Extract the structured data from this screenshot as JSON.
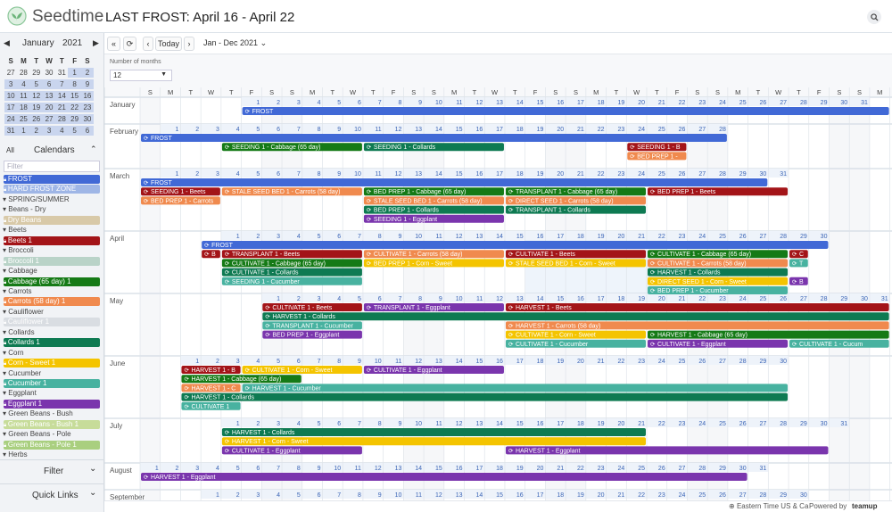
{
  "app": {
    "brand": "Seedtime",
    "title": "LAST FROST: April 16 - April 22"
  },
  "minical": {
    "month": "January",
    "year": "2021",
    "dow": [
      "S",
      "M",
      "T",
      "W",
      "T",
      "F",
      "S"
    ],
    "weeks": [
      [
        "27",
        "28",
        "29",
        "30",
        "31",
        "1",
        "2"
      ],
      [
        "3",
        "4",
        "5",
        "6",
        "7",
        "8",
        "9"
      ],
      [
        "10",
        "11",
        "12",
        "13",
        "14",
        "15",
        "16"
      ],
      [
        "17",
        "18",
        "19",
        "20",
        "21",
        "22",
        "23"
      ],
      [
        "24",
        "25",
        "26",
        "27",
        "28",
        "29",
        "30"
      ],
      [
        "31",
        "1",
        "2",
        "3",
        "4",
        "5",
        "6"
      ]
    ]
  },
  "sidebar": {
    "all_label": "All",
    "calendars_label": "Calendars",
    "filter_placeholder": "Filter",
    "filter_label": "Filter",
    "quicklinks_label": "Quick Links",
    "items": [
      {
        "label": "FROST",
        "kind": "cal",
        "color": "#4169d6",
        "text": "#fff",
        "icon": "lock"
      },
      {
        "label": "HARD FROST ZONE",
        "kind": "cal",
        "color": "#9fb6e6",
        "text": "#fff",
        "icon": "lock"
      },
      {
        "label": "SPRING/SUMMER",
        "kind": "group",
        "icon": "triangle"
      },
      {
        "label": "Beans - Dry",
        "kind": "group",
        "icon": "triangle"
      },
      {
        "label": "Dry Beans",
        "kind": "cal",
        "color": "#d8c9a8",
        "text": "#fff",
        "icon": "lock"
      },
      {
        "label": "Beets",
        "kind": "group",
        "icon": "triangle"
      },
      {
        "label": "Beets 1",
        "kind": "cal",
        "color": "#a31418",
        "text": "#fff",
        "icon": "lock"
      },
      {
        "label": "Broccoli",
        "kind": "group",
        "icon": "triangle"
      },
      {
        "label": "Broccoli 1",
        "kind": "cal",
        "color": "#b9d3c8",
        "text": "#fff",
        "icon": "lock"
      },
      {
        "label": "Cabbage",
        "kind": "group",
        "icon": "triangle"
      },
      {
        "label": "Cabbage (65 day) 1",
        "kind": "cal",
        "color": "#157a16",
        "text": "#fff",
        "icon": "lock"
      },
      {
        "label": "Carrots",
        "kind": "group",
        "icon": "triangle"
      },
      {
        "label": "Carrots (58 day) 1",
        "kind": "cal",
        "color": "#f08a4e",
        "text": "#fff",
        "icon": "lock"
      },
      {
        "label": "Cauliflower",
        "kind": "group",
        "icon": "triangle"
      },
      {
        "label": "Cauliflower 1",
        "kind": "cal",
        "color": "#d9dde2",
        "text": "#fff",
        "icon": "lock"
      },
      {
        "label": "Collards",
        "kind": "group",
        "icon": "triangle"
      },
      {
        "label": "Collards 1",
        "kind": "cal",
        "color": "#0e7a52",
        "text": "#fff",
        "icon": "lock"
      },
      {
        "label": "Corn",
        "kind": "group",
        "icon": "triangle"
      },
      {
        "label": "Corn - Sweet 1",
        "kind": "cal",
        "color": "#f4c400",
        "text": "#fff",
        "icon": "lock"
      },
      {
        "label": "Cucumber",
        "kind": "group",
        "icon": "triangle"
      },
      {
        "label": "Cucumber 1",
        "kind": "cal",
        "color": "#48b2a0",
        "text": "#fff",
        "icon": "lock"
      },
      {
        "label": "Eggplant",
        "kind": "group",
        "icon": "triangle"
      },
      {
        "label": "Eggplant 1",
        "kind": "cal",
        "color": "#7a35ad",
        "text": "#fff",
        "icon": "lock"
      },
      {
        "label": "Green Beans - Bush",
        "kind": "group",
        "icon": "triangle"
      },
      {
        "label": "Green Beans - Bush 1",
        "kind": "cal",
        "color": "#c7dc9a",
        "text": "#fff",
        "icon": "lock"
      },
      {
        "label": "Green Beans - Pole",
        "kind": "group",
        "icon": "triangle"
      },
      {
        "label": "Green Beans - Pole 1",
        "kind": "cal",
        "color": "#a9cf7f",
        "text": "#fff",
        "icon": "lock"
      },
      {
        "label": "Herbs",
        "kind": "group",
        "icon": "triangle"
      }
    ]
  },
  "toolbar": {
    "today": "Today",
    "range": "Jan - Dec 2021",
    "months_label": "Number of months",
    "months_value": "12"
  },
  "dow_header": [
    "S",
    "M",
    "T",
    "W",
    "T",
    "F",
    "S",
    "S",
    "M",
    "T",
    "W",
    "T",
    "F",
    "S",
    "S",
    "M",
    "T",
    "W",
    "T",
    "F",
    "S",
    "S",
    "M",
    "T",
    "W",
    "T",
    "F",
    "S",
    "S",
    "M",
    "T",
    "W",
    "T",
    "F",
    "S",
    "S",
    "M"
  ],
  "months": [
    {
      "name": "January",
      "start": 5,
      "days": 31
    },
    {
      "name": "February",
      "start": 1,
      "days": 28
    },
    {
      "name": "March",
      "start": 1,
      "days": 31
    },
    {
      "name": "April",
      "start": 4,
      "days": 30
    },
    {
      "name": "May",
      "start": 6,
      "days": 31
    },
    {
      "name": "June",
      "start": 2,
      "days": 30
    },
    {
      "name": "July",
      "start": 4,
      "days": 31
    },
    {
      "name": "August",
      "start": 0,
      "days": 31
    },
    {
      "name": "September",
      "start": 3,
      "days": 30
    }
  ],
  "colors": {
    "frost": "#4169d6",
    "beets": "#a31418",
    "cabbage": "#157a16",
    "carrots": "#f08a4e",
    "collards": "#0e7a52",
    "corn": "#f4c400",
    "cucumber": "#48b2a0",
    "eggplant": "#7a35ad",
    "frostzone": "#eef4fb"
  },
  "events": [
    {
      "m": 0,
      "lane": 0,
      "s": 5,
      "e": 36,
      "label": "FROST",
      "c": "frost"
    },
    {
      "m": 1,
      "lane": 0,
      "s": 0,
      "e": 28,
      "label": "FROST",
      "c": "frost"
    },
    {
      "m": 1,
      "lane": 1,
      "s": 4,
      "e": 10,
      "label": "SEEDING 1 - Cabbage (65 day)",
      "c": "cabbage"
    },
    {
      "m": 1,
      "lane": 1,
      "s": 11,
      "e": 17,
      "label": "SEEDING 1 - Collards",
      "c": "collards"
    },
    {
      "m": 1,
      "lane": 1,
      "s": 24,
      "e": 26,
      "label": "SEEDING 1 - B",
      "c": "beets"
    },
    {
      "m": 1,
      "lane": 2,
      "s": 24,
      "e": 26,
      "label": "BED PREP 1 -",
      "c": "carrots"
    },
    {
      "m": 2,
      "lane": 0,
      "s": 0,
      "e": 30,
      "label": "FROST",
      "c": "frost"
    },
    {
      "m": 2,
      "lane": 1,
      "s": 0,
      "e": 3,
      "label": "SEEDING 1 - Beets",
      "c": "beets"
    },
    {
      "m": 2,
      "lane": 1,
      "s": 4,
      "e": 10,
      "label": "STALE SEED BED 1 - Carrots (58 day)",
      "c": "carrots"
    },
    {
      "m": 2,
      "lane": 1,
      "s": 11,
      "e": 17,
      "label": "BED PREP 1 - Cabbage (65 day)",
      "c": "cabbage"
    },
    {
      "m": 2,
      "lane": 1,
      "s": 18,
      "e": 24,
      "label": "TRANSPLANT 1 - Cabbage (65 day)",
      "c": "cabbage"
    },
    {
      "m": 2,
      "lane": 1,
      "s": 25,
      "e": 31,
      "label": "BED PREP 1 - Beets",
      "c": "beets"
    },
    {
      "m": 2,
      "lane": 2,
      "s": 0,
      "e": 3,
      "label": "BED PREP 1 - Carrots",
      "c": "carrots"
    },
    {
      "m": 2,
      "lane": 2,
      "s": 11,
      "e": 17,
      "label": "STALE SEED BED 1 - Carrots (58 day)",
      "c": "carrots"
    },
    {
      "m": 2,
      "lane": 2,
      "s": 18,
      "e": 24,
      "label": "DIRECT SEED 1 - Carrots (58 day)",
      "c": "carrots"
    },
    {
      "m": 2,
      "lane": 3,
      "s": 11,
      "e": 17,
      "label": "BED PREP 1 - Collards",
      "c": "collards"
    },
    {
      "m": 2,
      "lane": 3,
      "s": 18,
      "e": 24,
      "label": "TRANSPLANT 1 - Collards",
      "c": "collards"
    },
    {
      "m": 2,
      "lane": 4,
      "s": 11,
      "e": 17,
      "label": "SEEDING 1 - Eggplant",
      "c": "eggplant"
    },
    {
      "m": 3,
      "lane": 0,
      "s": 3,
      "e": 33,
      "label": "FROST",
      "c": "frost"
    },
    {
      "m": 3,
      "lane": 1,
      "s": 3,
      "e": 3,
      "label": "B",
      "c": "beets"
    },
    {
      "m": 3,
      "lane": 1,
      "s": 4,
      "e": 10,
      "label": "TRANSPLANT 1 - Beets",
      "c": "beets"
    },
    {
      "m": 3,
      "lane": 1,
      "s": 11,
      "e": 17,
      "label": "CULTIVATE 1 - Carrots (58 day)",
      "c": "carrots"
    },
    {
      "m": 3,
      "lane": 1,
      "s": 18,
      "e": 24,
      "label": "CULTIVATE 1 - Beets",
      "c": "beets"
    },
    {
      "m": 3,
      "lane": 1,
      "s": 25,
      "e": 31,
      "label": "CULTIVATE 1 - Cabbage (65 day)",
      "c": "cabbage"
    },
    {
      "m": 3,
      "lane": 1,
      "s": 32,
      "e": 32,
      "label": "C",
      "c": "beets"
    },
    {
      "m": 3,
      "lane": 2,
      "s": 4,
      "e": 10,
      "label": "CULTIVATE 1 - Cabbage (65 day)",
      "c": "cabbage"
    },
    {
      "m": 3,
      "lane": 2,
      "s": 11,
      "e": 17,
      "label": "BED PREP 1 - Corn - Sweet",
      "c": "corn"
    },
    {
      "m": 3,
      "lane": 2,
      "s": 18,
      "e": 24,
      "label": "STALE SEED BED 1 - Corn - Sweet",
      "c": "corn"
    },
    {
      "m": 3,
      "lane": 2,
      "s": 25,
      "e": 31,
      "label": "CULTIVATE 1 - Carrots (58 day)",
      "c": "carrots"
    },
    {
      "m": 3,
      "lane": 2,
      "s": 32,
      "e": 32,
      "label": "T",
      "c": "cucumber"
    },
    {
      "m": 3,
      "lane": 3,
      "s": 4,
      "e": 10,
      "label": "CULTIVATE 1 - Collards",
      "c": "collards"
    },
    {
      "m": 3,
      "lane": 3,
      "s": 25,
      "e": 31,
      "label": "HARVEST 1 - Collards",
      "c": "collards"
    },
    {
      "m": 3,
      "lane": 4,
      "s": 4,
      "e": 10,
      "label": "SEEDING 1 - Cucumber",
      "c": "cucumber"
    },
    {
      "m": 3,
      "lane": 4,
      "s": 25,
      "e": 31,
      "label": "DIRECT SEED 1 - Corn - Sweet",
      "c": "corn"
    },
    {
      "m": 3,
      "lane": 4,
      "s": 32,
      "e": 32,
      "label": "B",
      "c": "eggplant"
    },
    {
      "m": 3,
      "lane": 5,
      "s": 25,
      "e": 31,
      "label": "BED PREP 1 - Cucumber",
      "c": "cucumber"
    },
    {
      "m": 4,
      "lane": 0,
      "s": 6,
      "e": 10,
      "label": "CULTIVATE 1 - Beets",
      "c": "beets"
    },
    {
      "m": 4,
      "lane": 0,
      "s": 11,
      "e": 17,
      "label": "TRANSPLANT 1 - Eggplant",
      "c": "eggplant"
    },
    {
      "m": 4,
      "lane": 0,
      "s": 18,
      "e": 36,
      "label": "HARVEST 1 - Beets",
      "c": "beets"
    },
    {
      "m": 4,
      "lane": 1,
      "s": 6,
      "e": 36,
      "label": "HARVEST 1 - Collards",
      "c": "collards"
    },
    {
      "m": 4,
      "lane": 2,
      "s": 6,
      "e": 10,
      "label": "TRANSPLANT 1 - Cucumber",
      "c": "cucumber"
    },
    {
      "m": 4,
      "lane": 2,
      "s": 18,
      "e": 36,
      "label": "HARVEST 1 - Carrots (58 day)",
      "c": "carrots"
    },
    {
      "m": 4,
      "lane": 3,
      "s": 6,
      "e": 10,
      "label": "BED PREP 1 - Eggplant",
      "c": "eggplant"
    },
    {
      "m": 4,
      "lane": 3,
      "s": 18,
      "e": 24,
      "label": "CULTIVATE 1 - Corn - Sweet",
      "c": "corn"
    },
    {
      "m": 4,
      "lane": 3,
      "s": 25,
      "e": 36,
      "label": "HARVEST 1 - Cabbage (65 day)",
      "c": "cabbage"
    },
    {
      "m": 4,
      "lane": 4,
      "s": 18,
      "e": 24,
      "label": "CULTIVATE 1 - Cucumber",
      "c": "cucumber"
    },
    {
      "m": 4,
      "lane": 4,
      "s": 25,
      "e": 31,
      "label": "CULTIVATE 1 - Eggplant",
      "c": "eggplant"
    },
    {
      "m": 4,
      "lane": 4,
      "s": 32,
      "e": 36,
      "label": "CULTIVATE 1 - Cucum",
      "c": "cucumber"
    },
    {
      "m": 5,
      "lane": 0,
      "s": 2,
      "e": 4,
      "label": "HARVEST 1 - B",
      "c": "beets"
    },
    {
      "m": 5,
      "lane": 0,
      "s": 5,
      "e": 10,
      "label": "CULTIVATE 1 - Corn - Sweet",
      "c": "corn"
    },
    {
      "m": 5,
      "lane": 0,
      "s": 11,
      "e": 17,
      "label": "CULTIVATE 1 - Eggplant",
      "c": "eggplant"
    },
    {
      "m": 5,
      "lane": 1,
      "s": 2,
      "e": 7,
      "label": "HARVEST 1 - Cabbage (65 day)",
      "c": "cabbage"
    },
    {
      "m": 5,
      "lane": 2,
      "s": 2,
      "e": 4,
      "label": "HARVEST 1 - C",
      "c": "carrots"
    },
    {
      "m": 5,
      "lane": 2,
      "s": 5,
      "e": 31,
      "label": "HARVEST 1 - Cucumber",
      "c": "cucumber"
    },
    {
      "m": 5,
      "lane": 3,
      "s": 2,
      "e": 31,
      "label": "HARVEST 1 - Collards",
      "c": "collards"
    },
    {
      "m": 5,
      "lane": 4,
      "s": 2,
      "e": 4,
      "label": "CULTIVATE 1",
      "c": "cucumber"
    },
    {
      "m": 6,
      "lane": 0,
      "s": 4,
      "e": 24,
      "label": "HARVEST 1 - Collards",
      "c": "collards"
    },
    {
      "m": 6,
      "lane": 1,
      "s": 4,
      "e": 24,
      "label": "HARVEST 1 - Corn - Sweet",
      "c": "corn"
    },
    {
      "m": 6,
      "lane": 2,
      "s": 4,
      "e": 10,
      "label": "CULTIVATE 1 - Eggplant",
      "c": "eggplant"
    },
    {
      "m": 6,
      "lane": 2,
      "s": 18,
      "e": 33,
      "label": "HARVEST 1 - Eggplant",
      "c": "eggplant"
    },
    {
      "m": 7,
      "lane": 0,
      "s": 0,
      "e": 29,
      "label": "HARVEST 1 - Eggplant",
      "c": "eggplant"
    }
  ],
  "footer": {
    "timezone": "Eastern Time US & Ca",
    "powered": "Powered by",
    "brand": "teamup"
  }
}
